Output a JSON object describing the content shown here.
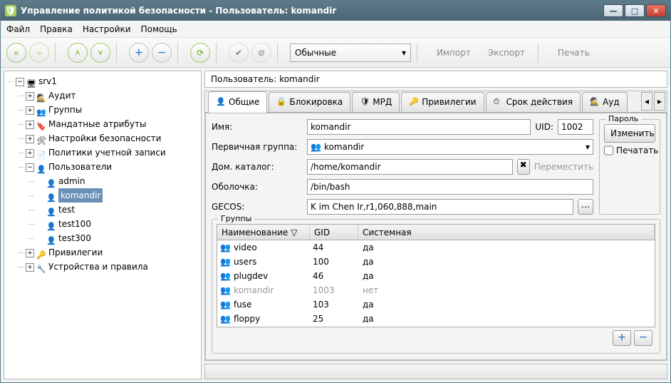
{
  "title": "Управление политикой безопасности - Пользователь: komandir",
  "menu": {
    "file": "Файл",
    "edit": "Правка",
    "settings": "Настройки",
    "help": "Помощь"
  },
  "toolbar_combo": "Обычные",
  "toolbar_links": {
    "import": "Импорт",
    "export": "Экспорт",
    "print": "Печать"
  },
  "tree": {
    "root": "srv1",
    "nodes": {
      "audit": "Аудит",
      "groups": "Группы",
      "mandatory": "Мандатные атрибуты",
      "secset": "Настройки безопасности",
      "accpol": "Политики учетной записи",
      "users": "Пользователи",
      "priv": "Привилегии",
      "devices": "Устройства и правила"
    },
    "users_children": [
      "admin",
      "komandir",
      "test",
      "test100",
      "test300"
    ],
    "selected": "komandir"
  },
  "infobar": "Пользователь: komandir",
  "tabs": {
    "general": "Общие",
    "blocking": "Блокировка",
    "mrd": "МРД",
    "privileges": "Привилегии",
    "expiry": "Срок действия",
    "aud": "Ауд"
  },
  "form": {
    "name_lbl": "Имя:",
    "name_val": "komandir",
    "uid_lbl": "UID:",
    "uid_val": "1002",
    "prigrp_lbl": "Первичная группа:",
    "prigrp_val": "komandir",
    "home_lbl": "Дом. каталог:",
    "home_val": "/home/komandir",
    "move_btn": "Переместить",
    "shell_lbl": "Оболочка:",
    "shell_val": "/bin/bash",
    "gecos_lbl": "GECOS:",
    "gecos_val": "K im Chen Ir,r1,060,888,main",
    "pass_title": "Пароль",
    "pass_change": "Изменить",
    "pass_print": "Печатать",
    "groups_title": "Группы",
    "col_name": "Наименование",
    "col_gid": "GID",
    "col_sys": "Системная",
    "groups": [
      {
        "name": "video",
        "gid": "44",
        "sys": "да",
        "disabled": false
      },
      {
        "name": "users",
        "gid": "100",
        "sys": "да",
        "disabled": false
      },
      {
        "name": "plugdev",
        "gid": "46",
        "sys": "да",
        "disabled": false
      },
      {
        "name": "komandir",
        "gid": "1003",
        "sys": "нет",
        "disabled": true
      },
      {
        "name": "fuse",
        "gid": "103",
        "sys": "да",
        "disabled": false
      },
      {
        "name": "floppy",
        "gid": "25",
        "sys": "да",
        "disabled": false
      }
    ]
  }
}
